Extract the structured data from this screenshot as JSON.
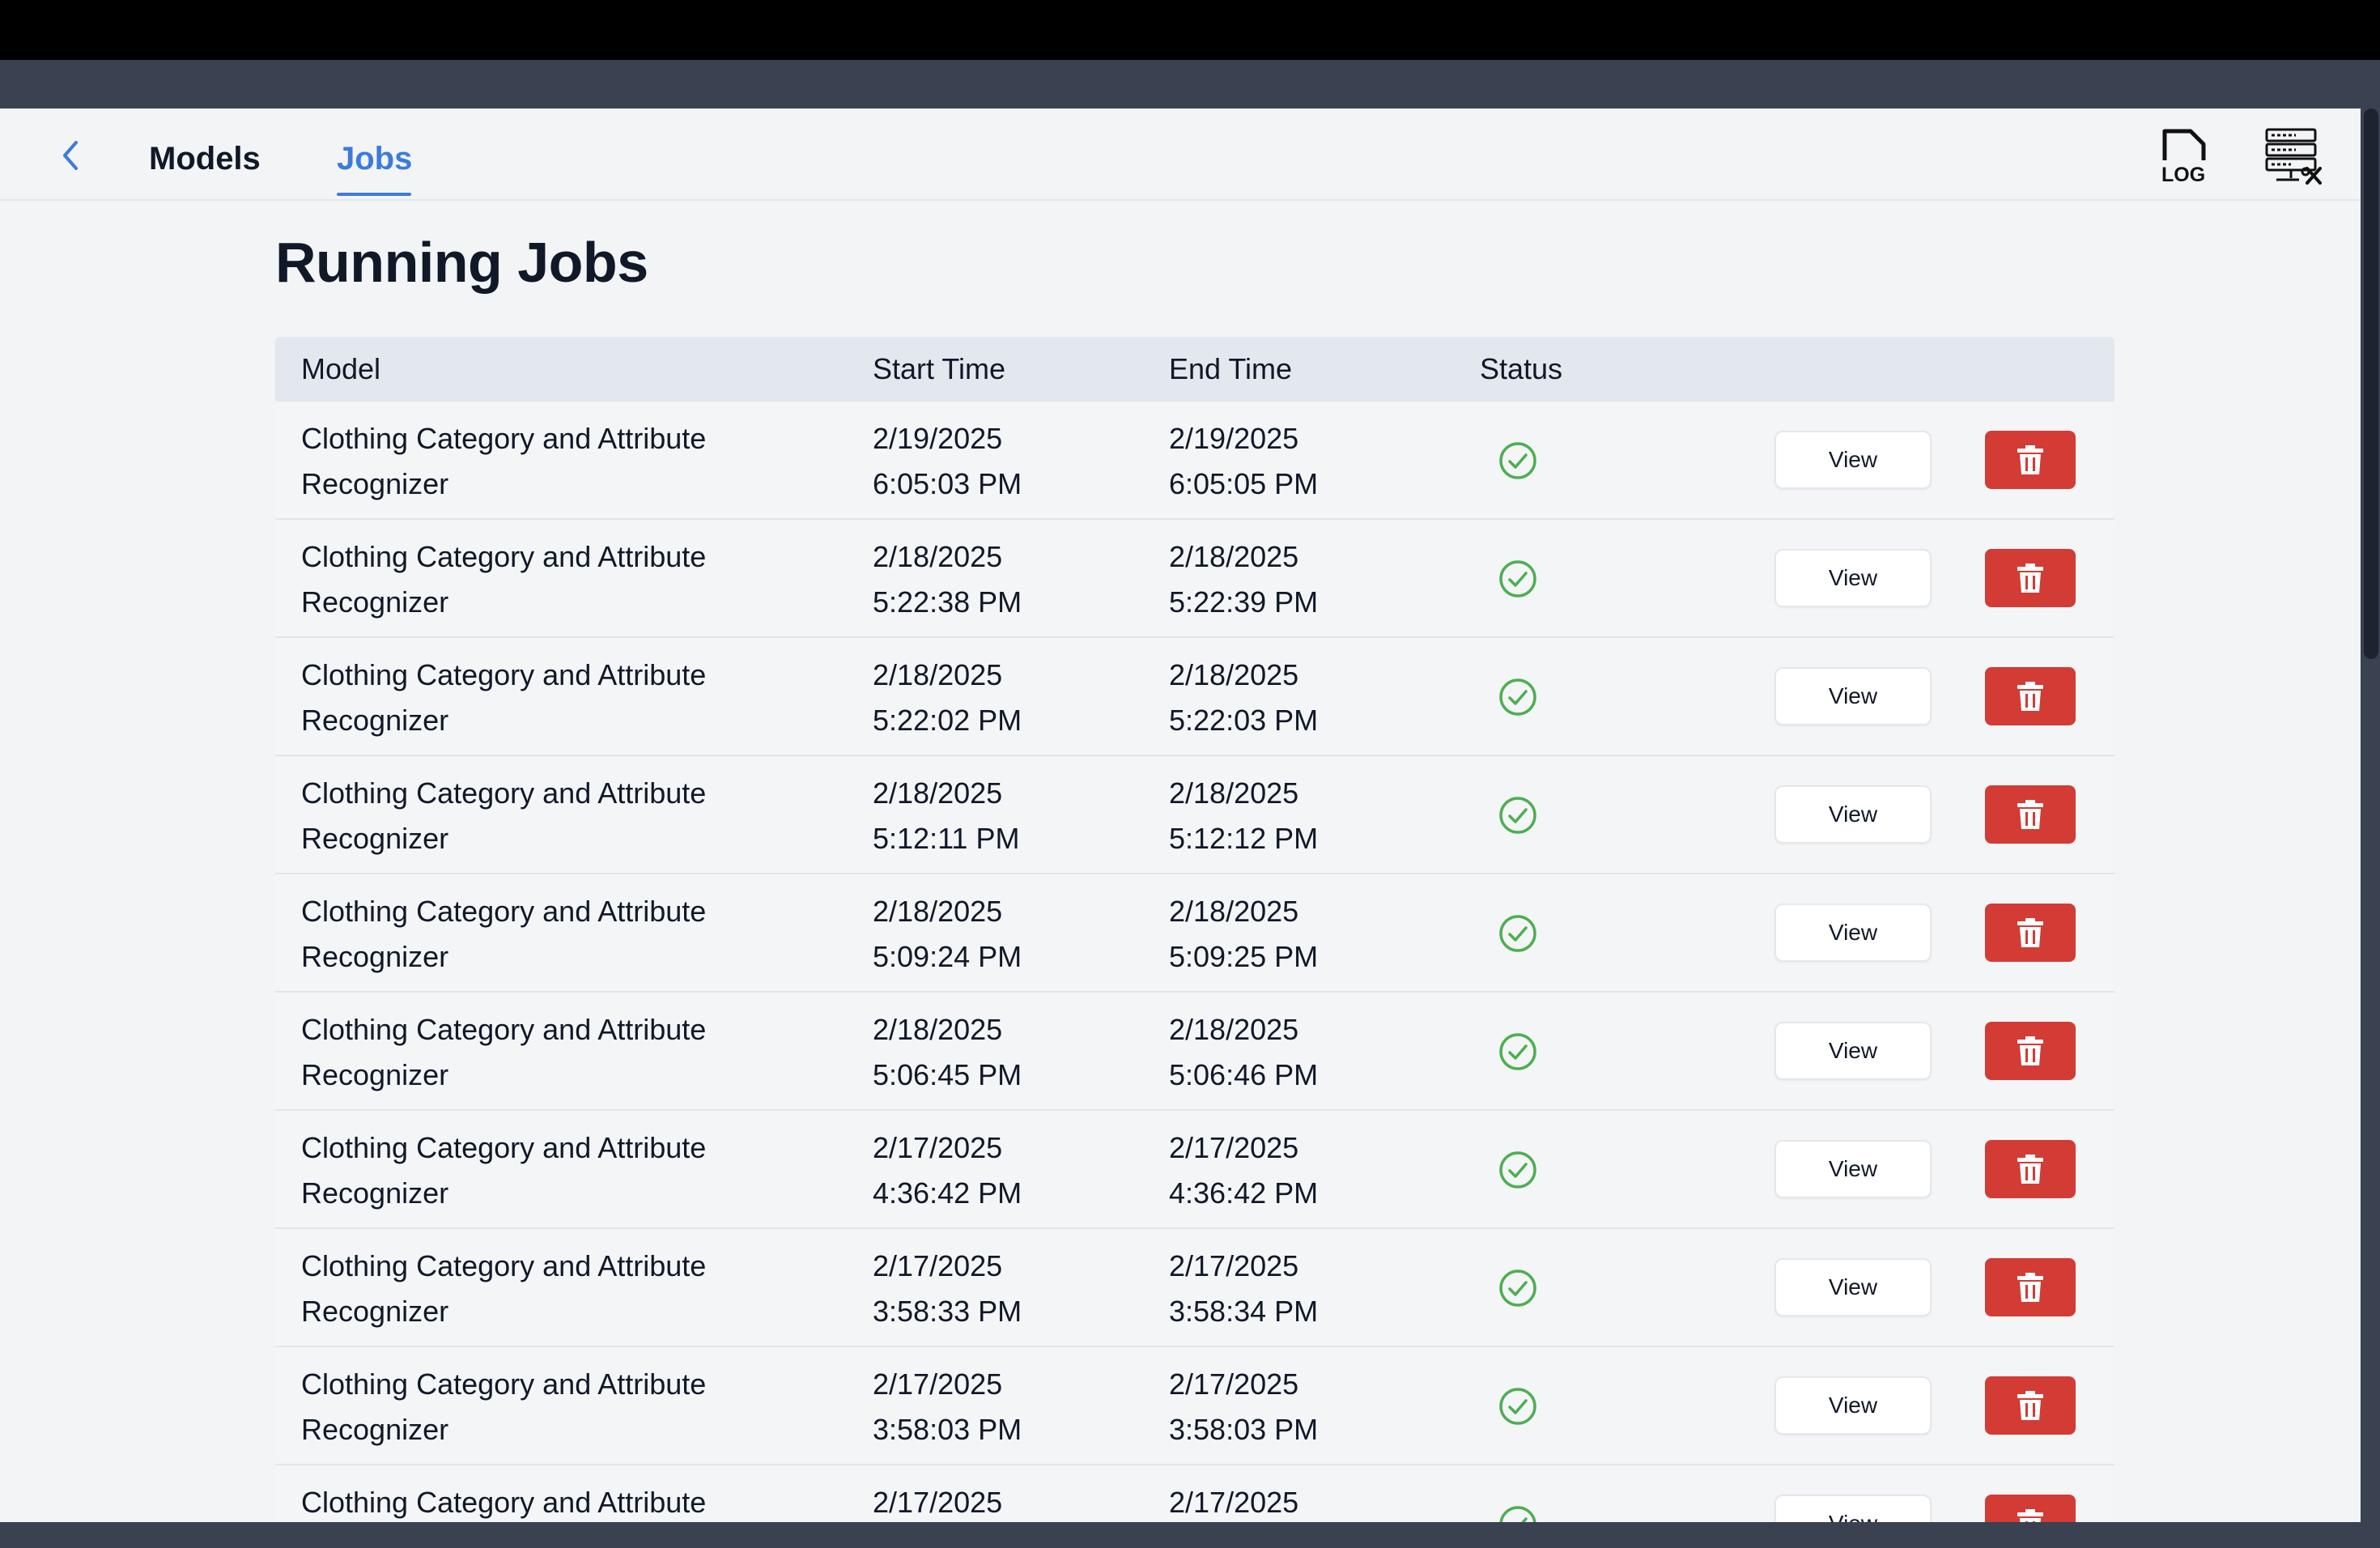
{
  "header": {
    "tabs": [
      {
        "label": "Models",
        "active": false
      },
      {
        "label": "Jobs",
        "active": true
      }
    ],
    "icons": [
      "back-chevron-icon",
      "log-file-icon",
      "server-settings-icon"
    ],
    "log_icon_text": "LOG",
    "accent_color": "#3b7bdc"
  },
  "page": {
    "title": "Running Jobs"
  },
  "table": {
    "columns": [
      "Model",
      "Start Time",
      "End Time",
      "Status"
    ],
    "view_label": "View",
    "status_color": "#4caf50",
    "delete_color": "#d33b35",
    "rows": [
      {
        "model": "Clothing Category and Attribute\nRecognizer",
        "start": "2/19/2025\n6:05:03 PM",
        "end": "2/19/2025\n6:05:05 PM",
        "status": "success"
      },
      {
        "model": "Clothing Category and Attribute\nRecognizer",
        "start": "2/18/2025\n5:22:38 PM",
        "end": "2/18/2025\n5:22:39 PM",
        "status": "success"
      },
      {
        "model": "Clothing Category and Attribute\nRecognizer",
        "start": "2/18/2025\n5:22:02 PM",
        "end": "2/18/2025\n5:22:03 PM",
        "status": "success"
      },
      {
        "model": "Clothing Category and Attribute\nRecognizer",
        "start": "2/18/2025\n5:12:11 PM",
        "end": "2/18/2025\n5:12:12 PM",
        "status": "success"
      },
      {
        "model": "Clothing Category and Attribute\nRecognizer",
        "start": "2/18/2025\n5:09:24 PM",
        "end": "2/18/2025\n5:09:25 PM",
        "status": "success"
      },
      {
        "model": "Clothing Category and Attribute\nRecognizer",
        "start": "2/18/2025\n5:06:45 PM",
        "end": "2/18/2025\n5:06:46 PM",
        "status": "success"
      },
      {
        "model": "Clothing Category and Attribute\nRecognizer",
        "start": "2/17/2025\n4:36:42 PM",
        "end": "2/17/2025\n4:36:42 PM",
        "status": "success"
      },
      {
        "model": "Clothing Category and Attribute\nRecognizer",
        "start": "2/17/2025\n3:58:33 PM",
        "end": "2/17/2025\n3:58:34 PM",
        "status": "success"
      },
      {
        "model": "Clothing Category and Attribute\nRecognizer",
        "start": "2/17/2025\n3:58:03 PM",
        "end": "2/17/2025\n3:58:03 PM",
        "status": "success"
      },
      {
        "model": "Clothing Category and Attribute",
        "start": "2/17/2025",
        "end": "2/17/2025",
        "status": "success"
      }
    ]
  }
}
